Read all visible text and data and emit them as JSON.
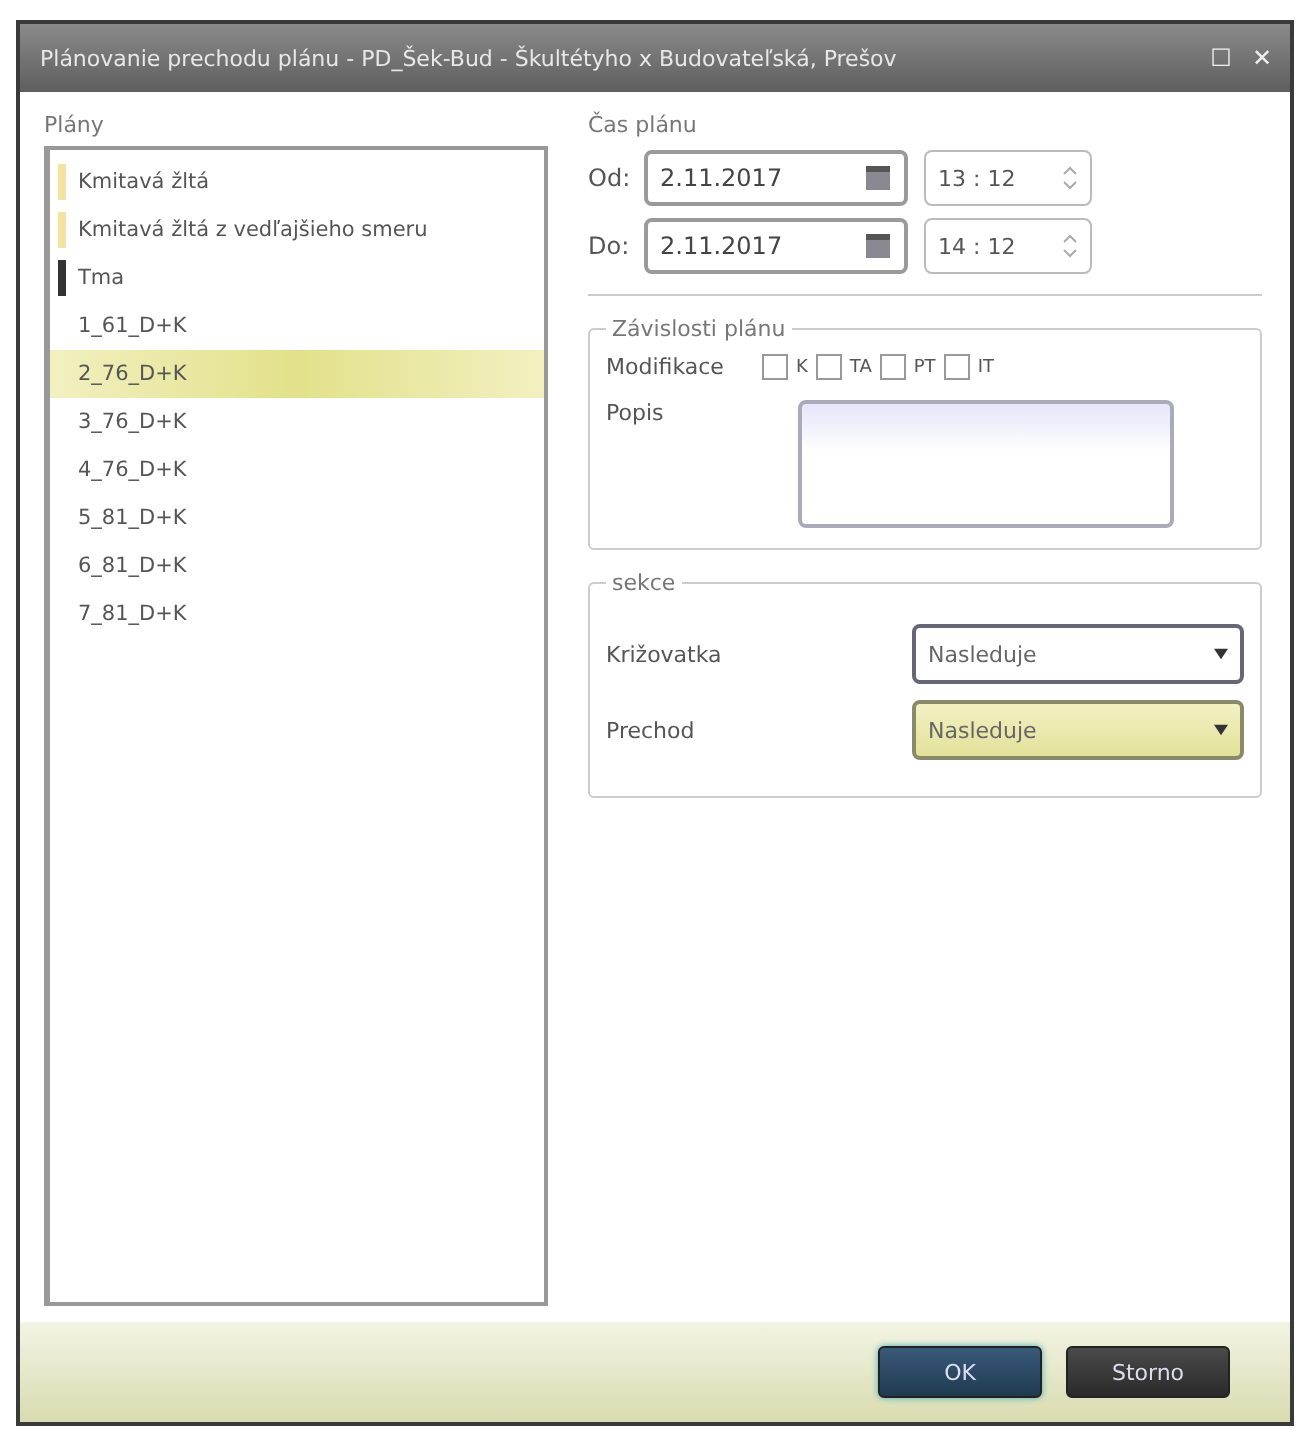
{
  "window": {
    "title": "Plánovanie prechodu plánu - PD_Šek-Bud - Škultétyho x Budovateľská, Prešov",
    "maximize": "☐",
    "close": "✕"
  },
  "plans": {
    "label": "Plány",
    "items": [
      {
        "label": "Kmitavá žltá",
        "color": "#f3e3a0",
        "selected": false
      },
      {
        "label": "Kmitavá žltá z vedľajšieho smeru",
        "color": "#f3e3a0",
        "selected": false
      },
      {
        "label": "Tma",
        "color": "#333333",
        "selected": false
      },
      {
        "label": "1_61_D+K",
        "selected": false
      },
      {
        "label": "2_76_D+K",
        "selected": true
      },
      {
        "label": "3_76_D+K",
        "selected": false
      },
      {
        "label": "4_76_D+K",
        "selected": false
      },
      {
        "label": "5_81_D+K",
        "selected": false
      },
      {
        "label": "6_81_D+K",
        "selected": false
      },
      {
        "label": "7_81_D+K",
        "selected": false
      }
    ]
  },
  "time": {
    "label": "Čas plánu",
    "rows": [
      {
        "label": "Od:",
        "date": "2.11.2017",
        "time": "13 : 12"
      },
      {
        "label": "Do:",
        "date": "2.11.2017",
        "time": "14 : 12"
      }
    ]
  },
  "dependencies": {
    "label": "Závislosti plánu",
    "modification_label": "Modifikace",
    "checkboxes": [
      {
        "label": "K",
        "checked": false
      },
      {
        "label": "TA",
        "checked": false
      },
      {
        "label": "PT",
        "checked": false
      },
      {
        "label": "IT",
        "checked": false
      }
    ],
    "description_label": "Popis"
  },
  "section": {
    "label": "sekce",
    "fields": [
      {
        "label": "Križovatka",
        "value": "Nasleduje",
        "highlighted": false
      },
      {
        "label": "Prechod",
        "value": "Nasleduje",
        "highlighted": true
      }
    ]
  },
  "buttons": [
    {
      "label": "OK",
      "kind": "primary"
    },
    {
      "label": "Storno",
      "kind": "secondary"
    }
  ]
}
